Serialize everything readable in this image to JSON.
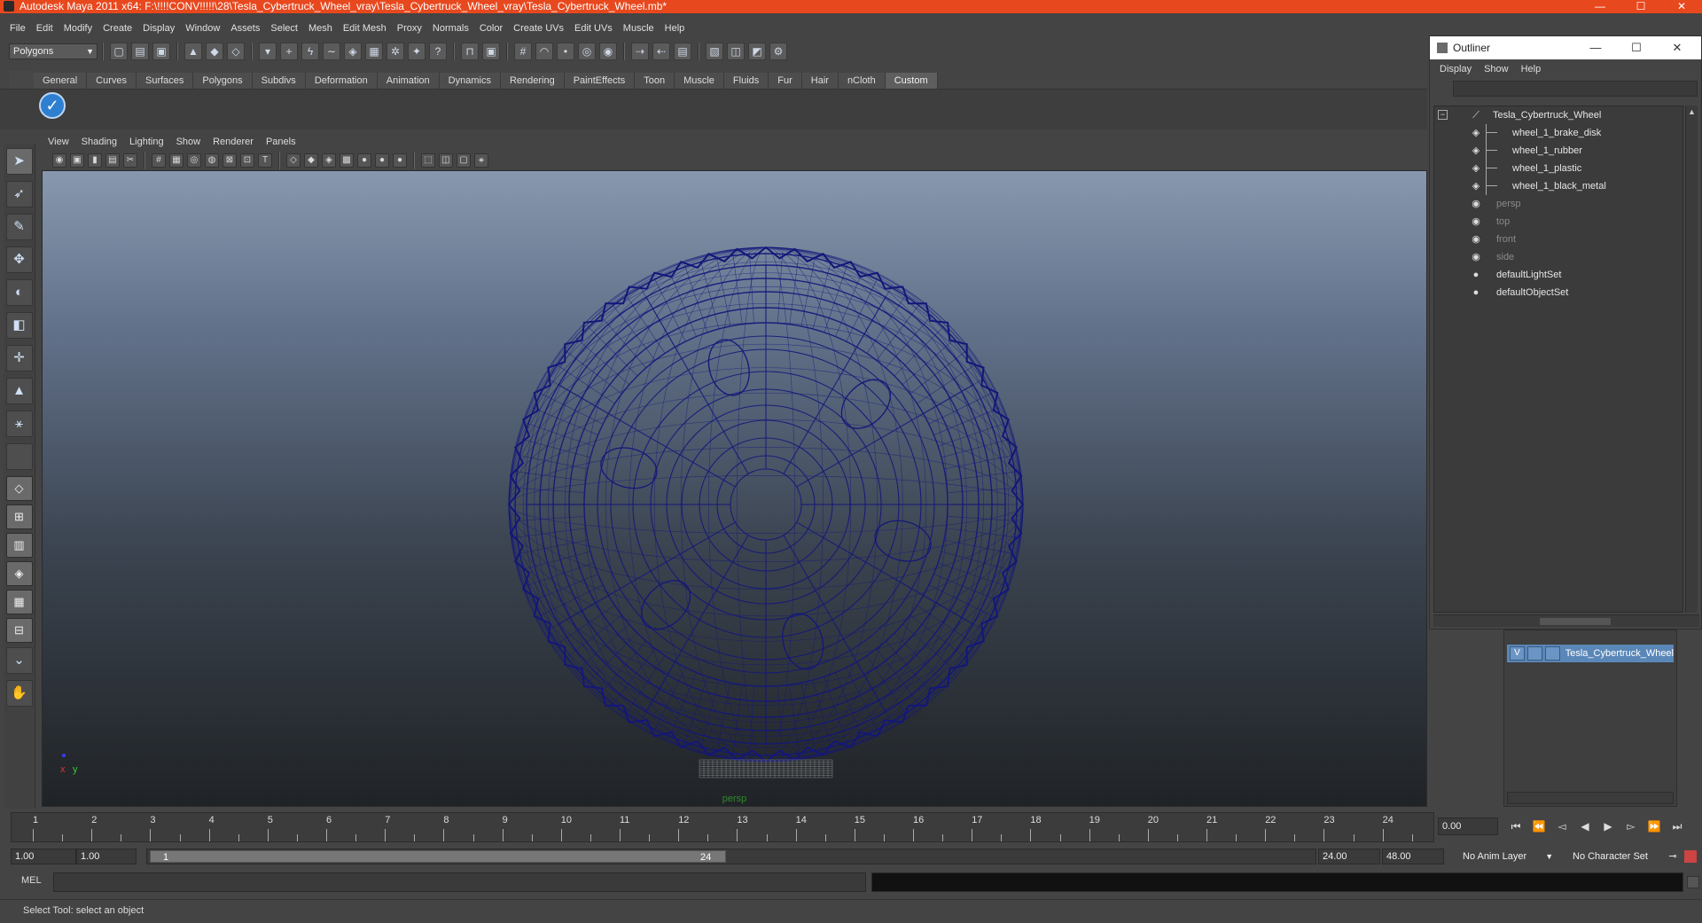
{
  "window": {
    "title": "Autodesk Maya 2011 x64: F:\\!!!!CONV!!!!!\\28\\Tesla_Cybertruck_Wheel_vray\\Tesla_Cybertruck_Wheel_vray\\Tesla_Cybertruck_Wheel.mb*",
    "minimize": "—",
    "maximize": "☐",
    "close": "✕",
    "accent": "#e8481e"
  },
  "menubar": [
    "File",
    "Edit",
    "Modify",
    "Create",
    "Display",
    "Window",
    "Assets",
    "Select",
    "Mesh",
    "Edit Mesh",
    "Proxy",
    "Normals",
    "Color",
    "Create UVs",
    "Edit UVs",
    "Muscle",
    "Help"
  ],
  "statusline": {
    "mode": "Polygons"
  },
  "shelf": {
    "tabs": [
      "General",
      "Curves",
      "Surfaces",
      "Polygons",
      "Subdivs",
      "Deformation",
      "Animation",
      "Dynamics",
      "Rendering",
      "PaintEffects",
      "Toon",
      "Muscle",
      "Fluids",
      "Fur",
      "Hair",
      "nCloth",
      "Custom"
    ],
    "active_tab": "Custom"
  },
  "viewport": {
    "menus": [
      "View",
      "Shading",
      "Lighting",
      "Show",
      "Renderer",
      "Panels"
    ],
    "camera_label": "persp",
    "axis_x": "x",
    "axis_y": "y",
    "wire_color": "#14177a"
  },
  "outliner": {
    "title": "Outliner",
    "menus": [
      "Display",
      "Show",
      "Help"
    ],
    "items": [
      {
        "label": "Tesla_Cybertruck_Wheel",
        "indent": 0,
        "dim": false,
        "icon": "transform-icon"
      },
      {
        "label": "wheel_1_brake_disk",
        "indent": 1,
        "dim": false,
        "icon": "mesh-icon"
      },
      {
        "label": "wheel_1_rubber",
        "indent": 1,
        "dim": false,
        "icon": "mesh-icon"
      },
      {
        "label": "wheel_1_plastic",
        "indent": 1,
        "dim": false,
        "icon": "mesh-icon"
      },
      {
        "label": "wheel_1_black_metal",
        "indent": 1,
        "dim": false,
        "icon": "mesh-icon"
      },
      {
        "label": "persp",
        "indent": 0,
        "dim": true,
        "icon": "camera-icon"
      },
      {
        "label": "top",
        "indent": 0,
        "dim": true,
        "icon": "camera-icon"
      },
      {
        "label": "front",
        "indent": 0,
        "dim": true,
        "icon": "camera-icon"
      },
      {
        "label": "side",
        "indent": 0,
        "dim": true,
        "icon": "camera-icon"
      },
      {
        "label": "defaultLightSet",
        "indent": 0,
        "dim": false,
        "icon": "set-icon"
      },
      {
        "label": "defaultObjectSet",
        "indent": 0,
        "dim": false,
        "icon": "set-icon"
      }
    ]
  },
  "layer_editor": {
    "layer_visible": "V",
    "layer_name": "Tesla_Cybertruck_Wheel",
    "layer_color": "#5a87b8"
  },
  "timeslider": {
    "ticks": [
      "1",
      "2",
      "3",
      "4",
      "5",
      "6",
      "7",
      "8",
      "9",
      "10",
      "11",
      "12",
      "13",
      "14",
      "15",
      "16",
      "17",
      "18",
      "19",
      "20",
      "21",
      "22",
      "23",
      "24"
    ],
    "current_time": "0.00"
  },
  "range": {
    "start": "1.00",
    "playback_start": "1.00",
    "thumb_start": "1",
    "thumb_end": "24",
    "playback_end": "24.00",
    "end": "48.00",
    "anim_layer": "No Anim Layer",
    "character_set": "No Character Set"
  },
  "cmdline": {
    "label": "MEL"
  },
  "helpline": {
    "text": "Select Tool: select an object"
  }
}
